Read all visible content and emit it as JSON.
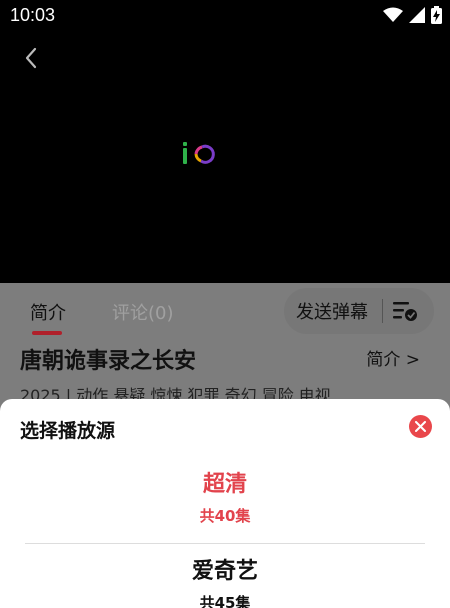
{
  "status_bar": {
    "time": "10:03",
    "icons": [
      "wifi-icon",
      "signal-icon",
      "battery-icon"
    ]
  },
  "player": {
    "icons": [
      "back-arrow-icon",
      "loading-logo-icon"
    ]
  },
  "tabs": [
    {
      "label": "简介",
      "active": true
    },
    {
      "label": "评论(0)",
      "active": false
    }
  ],
  "danmaku": {
    "label": "发送弹幕",
    "icon": "danmaku-settings-icon"
  },
  "show": {
    "title": "唐朝诡事录之长安",
    "intro_link": "简介 >",
    "meta": "2025 | 动作,悬疑,惊悚,犯罪,奇幻,冒险,电视"
  },
  "sheet": {
    "title": "选择播放源",
    "close_icon": "close-icon",
    "sources": [
      {
        "name": "超清",
        "count": "共40集",
        "selected": true
      },
      {
        "name": "爱奇艺",
        "count": "共45集",
        "selected": false
      }
    ]
  },
  "colors": {
    "accent": "#e2434c",
    "tab_indicator": "#b0202b",
    "overlay": "#7d7d7d"
  }
}
